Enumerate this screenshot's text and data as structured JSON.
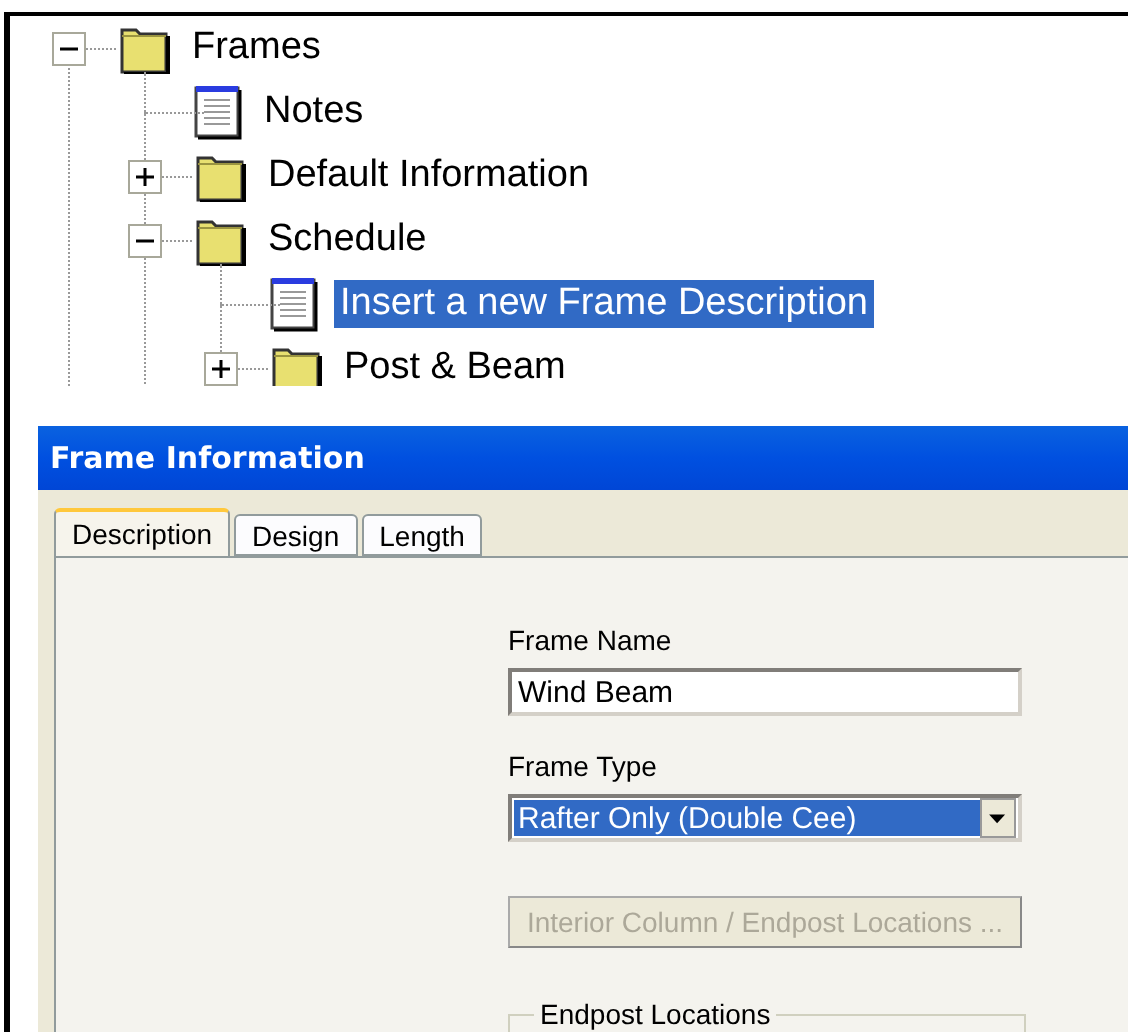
{
  "tree": [
    {
      "label": "Frames",
      "kind": "folder",
      "expanded": true,
      "selected": false,
      "children": [
        {
          "label": "Notes",
          "kind": "document",
          "selected": false
        },
        {
          "label": "Default Information",
          "kind": "folder",
          "expanded": false,
          "selected": false
        },
        {
          "label": "Schedule",
          "kind": "folder",
          "expanded": true,
          "selected": false,
          "children": [
            {
              "label": "Insert a new Frame Description",
              "kind": "document",
              "selected": true
            },
            {
              "label": "Post & Beam",
              "kind": "folder",
              "expanded": false,
              "selected": false
            }
          ]
        }
      ]
    }
  ],
  "dialog": {
    "title": "Frame Information",
    "tabs": [
      {
        "label": "Description",
        "selected": true
      },
      {
        "label": "Design",
        "selected": false
      },
      {
        "label": "Length",
        "selected": false
      }
    ],
    "frame_name": {
      "label": "Frame Name",
      "value": "Wind Beam"
    },
    "frame_type": {
      "label": "Frame Type",
      "value": "Rafter Only (Double Cee)",
      "highlighted": true
    },
    "button": {
      "label": "Interior Column / Endpost Locations ...",
      "disabled": true
    },
    "group": {
      "label": "Endpost Locations"
    }
  }
}
